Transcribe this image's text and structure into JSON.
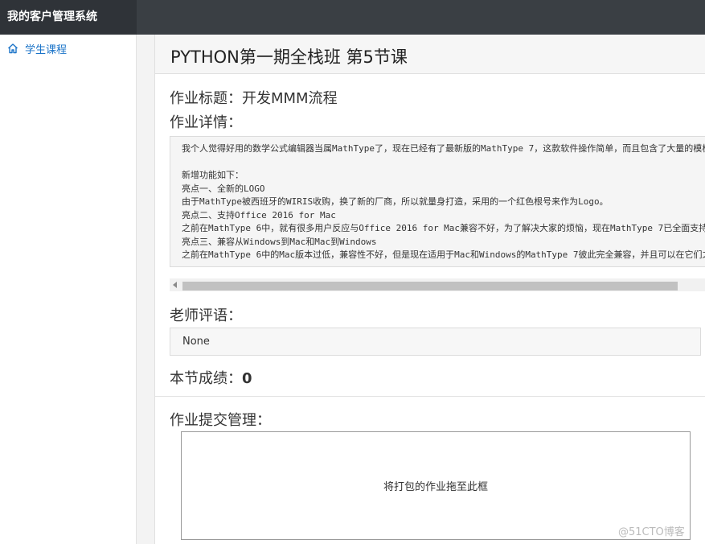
{
  "app": {
    "brand": "我的客户管理系统"
  },
  "sidebar": {
    "items": [
      {
        "label": "学生课程",
        "icon": "home-icon"
      }
    ]
  },
  "page": {
    "title": "PYTHON第一期全栈班 第5节课",
    "homework_title": "作业标题：开发MMM流程",
    "homework_detail_label": "作业详情：",
    "homework_detail_lines": [
      "我个人觉得好用的数学公式编辑器当属MathType了，现在已经有了最新版的MathType 7，这款软件操作简单，而且包含了大量的模板",
      "",
      "新增功能如下：",
      "亮点一、全新的LOGO",
      "由于MathType被西班牙的WIRIS收购，换了新的厂商，所以就量身打造，采用的一个红色根号来作为Logo。",
      "亮点二、支持Office 2016 for Mac",
      "之前在MathType 6中，就有很多用户反应与Office 2016 for Mac兼容不好，为了解决大家的烦恼，现在MathType 7已全面支持",
      "亮点三、兼容从Windows到Mac和Mac到Windows",
      "之前在MathType 6中的Mac版本过低，兼容性不好，但是现在适用于Mac和Windows的MathType 7彼此完全兼容，并且可以在它们之间"
    ],
    "teacher_comment_label": "老师评语：",
    "teacher_comment": "None",
    "score_label": "本节成绩：",
    "score_value": "0",
    "submit_label": "作业提交管理：",
    "dropzone_text": "将打包的作业拖至此框"
  },
  "watermark": "@51CTO博客",
  "colors": {
    "topbar": "#3a3f44",
    "brand_bg": "#2f3338",
    "link": "#1a73c8"
  }
}
